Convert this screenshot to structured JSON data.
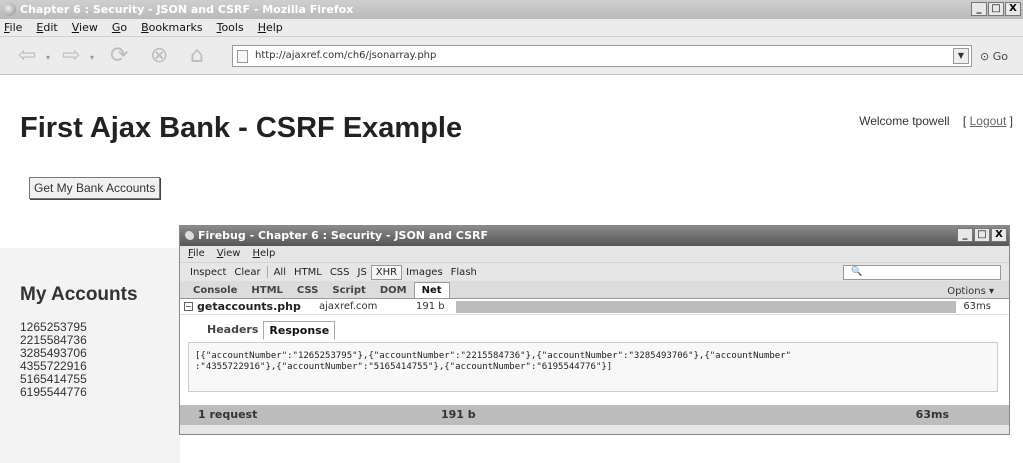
{
  "browser": {
    "title": "Chapter 6 : Security - JSON and CSRF - Mozilla Firefox",
    "menu": [
      "File",
      "Edit",
      "View",
      "Go",
      "Bookmarks",
      "Tools",
      "Help"
    ],
    "url": "http://ajaxref.com/ch6/jsonarray.php",
    "go_label": "Go",
    "window_buttons": [
      "_",
      "□",
      "X"
    ]
  },
  "page": {
    "title": "First Ajax Bank - CSRF Example",
    "welcome": "Welcome tpowell",
    "logout_prefix": "[",
    "logout_label": "Logout",
    "logout_suffix": "]",
    "button_label": "Get My Bank Accounts",
    "accounts_heading": "My Accounts",
    "accounts": [
      "1265253795",
      "2215584736",
      "3285493706",
      "4355722916",
      "5165414755",
      "6195544776"
    ]
  },
  "firebug": {
    "title": "Firebug - Chapter 6 : Security - JSON and CSRF",
    "menu": [
      "File",
      "View",
      "Help"
    ],
    "toolbar": [
      "Inspect",
      "Clear",
      "All",
      "HTML",
      "CSS",
      "JS",
      "XHR",
      "Images",
      "Flash"
    ],
    "tabs": [
      "Console",
      "HTML",
      "CSS",
      "Script",
      "DOM",
      "Net"
    ],
    "options_label": "Options ▾",
    "request": {
      "file": "getaccounts.php",
      "domain": "ajaxref.com",
      "size": "191 b",
      "time": "63ms",
      "expand": "−"
    },
    "detail_tabs": [
      "Headers",
      "Response"
    ],
    "response": "[{\"accountNumber\":\"1265253795\"},{\"accountNumber\":\"2215584736\"},{\"accountNumber\":\"3285493706\"},{\"accountNumber\"\n:\"4355722916\"},{\"accountNumber\":\"5165414755\"},{\"accountNumber\":\"6195544776\"}]",
    "summary": {
      "requests": "1 request",
      "size": "191 b",
      "time": "63ms"
    }
  }
}
